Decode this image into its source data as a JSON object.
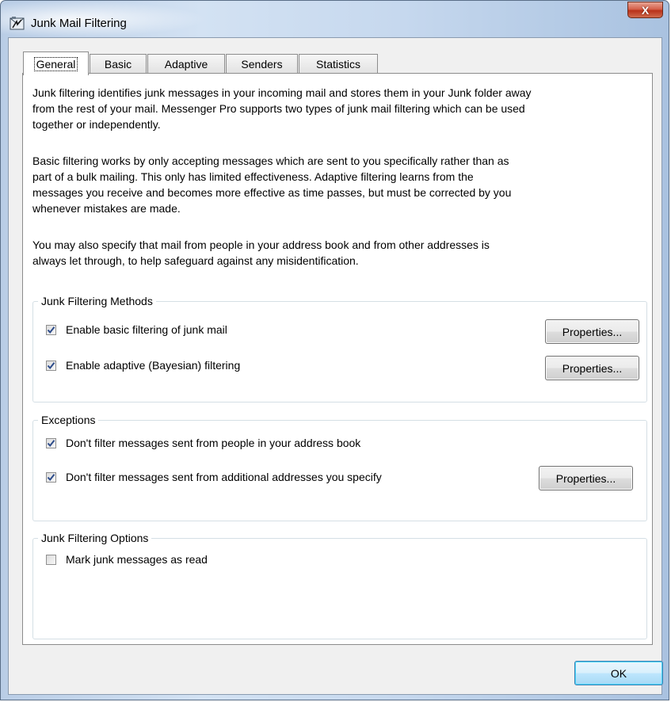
{
  "window": {
    "title": "Junk Mail Filtering",
    "close_glyph": "X",
    "icon": "junk-filter-app-icon"
  },
  "tabs": [
    {
      "label": "General",
      "active": true
    },
    {
      "label": "Basic",
      "active": false
    },
    {
      "label": "Adaptive",
      "active": false
    },
    {
      "label": "Senders",
      "active": false
    },
    {
      "label": "Statistics",
      "active": false
    }
  ],
  "general": {
    "paragraphs": [
      "Junk filtering identifies junk messages in your incoming mail and stores them in your Junk folder away from the rest of your mail.  Messenger Pro supports two types of junk mail filtering which can be used together or independently.",
      "Basic filtering works by only accepting messages which are sent to you specifically rather than as part of a bulk mailing.  This only has limited effectiveness.  Adaptive filtering learns from the messages you receive and becomes more effective as time passes, but must be corrected by you whenever mistakes are made.",
      "You may also specify that mail from people in your address book and from other addresses is always let through, to help safeguard against any misidentification."
    ],
    "methods": {
      "title": "Junk Filtering Methods",
      "options": [
        {
          "label": "Enable basic filtering of junk mail",
          "checked": true,
          "button": "Properties..."
        },
        {
          "label": "Enable adaptive (Bayesian) filtering",
          "checked": true,
          "button": "Properties..."
        }
      ]
    },
    "exceptions": {
      "title": "Exceptions",
      "options": [
        {
          "label": "Don't filter messages sent from people in your address book",
          "checked": true
        },
        {
          "label": "Don't filter messages sent from additional addresses you specify",
          "checked": true,
          "button": "Properties..."
        }
      ]
    },
    "filtering_options": {
      "title": "Junk Filtering Options",
      "options": [
        {
          "label": "Mark junk messages as read",
          "checked": false
        }
      ]
    }
  },
  "footer": {
    "ok_label": "OK"
  },
  "colors": {
    "titlebar": "#c6d8ee",
    "close_button": "#c8442a",
    "dialog_face": "#f0f0f0",
    "checkmark": "#2c4b8a"
  }
}
